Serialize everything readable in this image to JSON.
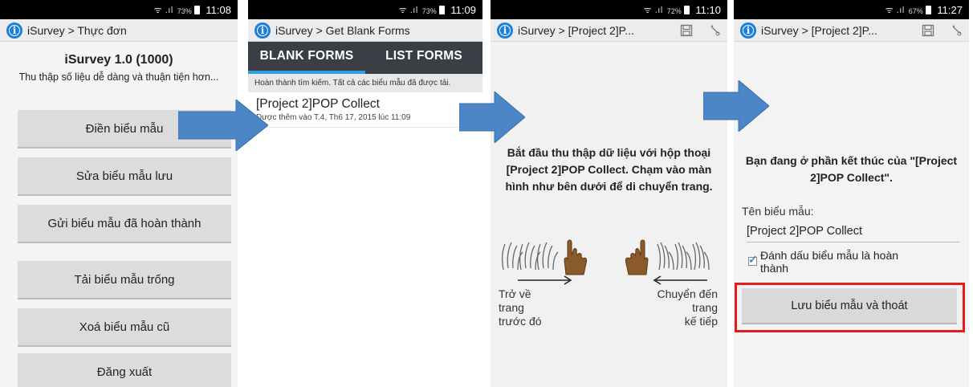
{
  "status_bars": [
    {
      "signal": "ᯤ .ıl",
      "battery": "73%",
      "time": "11:08"
    },
    {
      "signal": "ᯤ .ıl",
      "battery": "73%",
      "time": "11:09"
    },
    {
      "signal": "ᯤ .ıl",
      "battery": "72%",
      "time": "11:10"
    },
    {
      "signal": "ᯤ .ıl",
      "battery": "67%",
      "time": "11:27"
    }
  ],
  "screen1": {
    "title": "iSurvey > Thực đơn",
    "heading": "iSurvey 1.0 (1000)",
    "subtitle": "Thu thập số liệu dễ dàng và thuận tiện hơn...",
    "buttons": [
      "Điền biểu mẫu",
      "Sửa biểu mẫu lưu",
      "Gửi biểu mẫu đã hoàn thành",
      "Tải biểu mẫu trống",
      "Xoá biểu mẫu cũ",
      "Đăng xuất"
    ]
  },
  "screen2": {
    "title": "iSurvey > Get Blank Forms",
    "tabs": [
      "BLANK FORMS",
      "LIST FORMS"
    ],
    "notice": "Hoàn thành tìm kiếm. Tất cả các biểu mẫu đã được tải.",
    "form_name": "[Project 2]POP Collect",
    "form_date": "Được thêm vào T.4, Th6 17, 2015 lúc 11:09"
  },
  "screen3": {
    "title": "iSurvey > [Project 2]P...",
    "instruction": "Bắt đầu thu thập dữ liệu với hộp thoại [Project 2]POP Collect. Chạm vào màn hình như bên dưới để di chuyển trang.",
    "prev_label": [
      "Trở về",
      "trang",
      "trước đó"
    ],
    "next_label": [
      "Chuyển đến",
      "trang",
      "kế tiếp"
    ]
  },
  "screen4": {
    "title": "iSurvey > [Project 2]P...",
    "end_text": "Bạn đang ở phần kết thúc của \"[Project 2]POP Collect\".",
    "field_label": "Tên biểu mẫu:",
    "field_value": "[Project 2]POP Collect",
    "checkbox_label": "Đánh dấu biểu mẫu là hoàn thành",
    "checkbox_checked": true,
    "save_button": "Lưu biểu mẫu và thoát"
  },
  "colors": {
    "arrow": "#4d86c6",
    "highlight": "#e51c1c",
    "tab_accent": "#2d9ee0",
    "tab_bar": "#3a3f45"
  },
  "icons": [
    "isurvey-info-icon",
    "save-icon",
    "sign-icon",
    "swipe-hand-icon",
    "arrow-right-icon"
  ]
}
